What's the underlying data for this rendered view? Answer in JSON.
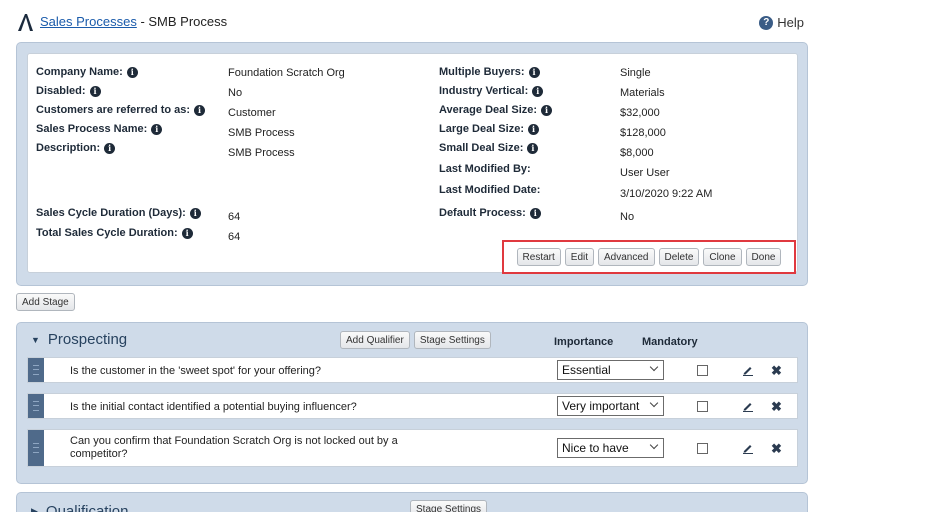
{
  "header": {
    "breadcrumb_link": "Sales Processes",
    "breadcrumb_rest": " - SMB Process",
    "help_label": "Help"
  },
  "details": {
    "left": [
      {
        "label": "Company Name:",
        "value": "Foundation Scratch Org"
      },
      {
        "label": "Disabled:",
        "value": "No"
      },
      {
        "label": "Customers are referred to as:",
        "value": "Customer"
      },
      {
        "label": "Sales Process Name:",
        "value": "SMB Process"
      },
      {
        "label": "Description:",
        "value": "SMB Process"
      },
      {
        "label": "Sales Cycle Duration (Days):",
        "value": "64"
      },
      {
        "label": "Total Sales Cycle Duration:",
        "value": "64"
      }
    ],
    "right": [
      {
        "label": "Multiple Buyers:",
        "value": "Single"
      },
      {
        "label": "Industry Vertical:",
        "value": "Materials"
      },
      {
        "label": "Average Deal Size:",
        "value": "$32,000"
      },
      {
        "label": "Large Deal Size:",
        "value": "$128,000"
      },
      {
        "label": "Small Deal Size:",
        "value": "$8,000"
      },
      {
        "label": "Last Modified By:",
        "value": "User User"
      },
      {
        "label": "Last Modified Date:",
        "value": "3/10/2020 9:22 AM"
      },
      {
        "label": "Default Process:",
        "value": "No"
      }
    ]
  },
  "actions": [
    "Restart",
    "Edit",
    "Advanced",
    "Delete",
    "Clone",
    "Done"
  ],
  "add_stage_label": "Add Stage",
  "stages": [
    {
      "title": "Prospecting",
      "add_qualifier_label": "Add Qualifier",
      "stage_settings_label": "Stage Settings",
      "importance_header": "Importance",
      "mandatory_header": "Mandatory",
      "qualifiers": [
        {
          "text": "Is the customer in the 'sweet spot' for your offering?",
          "importance": "Essential",
          "mandatory": false
        },
        {
          "text": "Is the initial contact identified a potential buying influencer?",
          "importance": "Very important",
          "mandatory": false
        },
        {
          "text": "Can you confirm that Foundation Scratch Org is not locked out by a competitor?",
          "importance": "Nice to have",
          "mandatory": false
        }
      ]
    },
    {
      "title": "Qualification",
      "stage_settings_label": "Stage Settings"
    }
  ],
  "icons": {
    "logo": "logo-icon",
    "help": "help-circle-icon",
    "info": "info-icon",
    "grip": "drag-handle-icon",
    "edit": "pencil-icon",
    "delete": "close-icon",
    "expanded": "triangle-down-icon",
    "collapsed": "triangle-right-icon"
  },
  "colors": {
    "link": "#1a5bab",
    "panel": "#cfdbe9",
    "highlight": "#e0393f",
    "grip": "#4f6a8a"
  }
}
